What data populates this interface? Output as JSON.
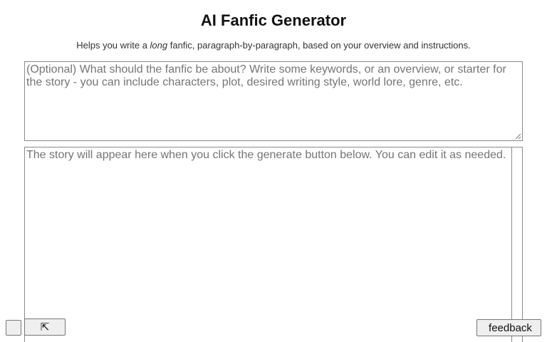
{
  "header": {
    "title": "AI Fanfic Generator",
    "subtitle_before": "Helps you write a ",
    "subtitle_emphasis": "long",
    "subtitle_after": " fanfic, paragraph-by-paragraph, based on your overview and instructions."
  },
  "overview_input": {
    "value": "",
    "placeholder": "(Optional) What should the fanfic be about? Write some keywords, or an overview, or starter for the story - you can include characters, plot, desired writing style, world lore, genre, etc."
  },
  "story_output": {
    "value": "",
    "placeholder": "The story will appear here when you click the generate button below. You can edit it as needed."
  },
  "footer": {
    "menu_glyph": "",
    "expand_glyph": "⇱",
    "feedback_glyph": "",
    "feedback_label": "feedback"
  },
  "icons": {
    "menu": "menu-icon",
    "expand": "expand-corner-icon",
    "feedback": "feedback-icon"
  },
  "colors": {
    "border": "#8a8a8a",
    "button_bg": "#efefef",
    "placeholder": "#757575"
  }
}
